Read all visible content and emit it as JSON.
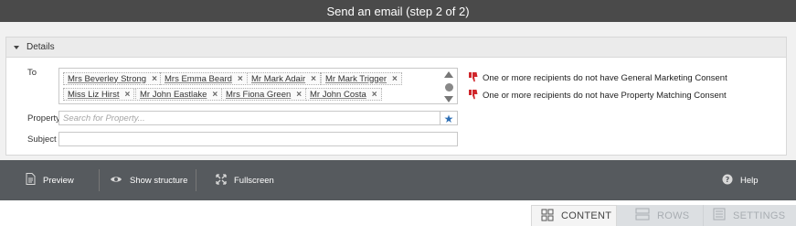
{
  "window": {
    "title": "Send an email (step 2 of 2)"
  },
  "details": {
    "header": "Details",
    "to_label": "To",
    "recipients": [
      "Mrs Beverley Strong",
      "Mrs Emma Beard",
      "Mr Mark Adair",
      "Mr Mark Trigger",
      "Miss Liz Hirst",
      "Mr John Eastlake",
      "Mrs Fiona Green",
      "Mr John Costa"
    ],
    "remove_glyph": "×",
    "property_label": "Property",
    "property_placeholder": "Search for Property...",
    "subject_label": "Subject",
    "subject_value": "",
    "warnings": [
      "One or more recipients do not have General Marketing Consent",
      "One or more recipients do not have Property Matching Consent"
    ]
  },
  "toolbar": {
    "preview": "Preview",
    "show_structure": "Show structure",
    "fullscreen": "Fullscreen",
    "help": "Help"
  },
  "tabs": [
    {
      "label": "CONTENT",
      "icon": "grid-icon",
      "active": true
    },
    {
      "label": "ROWS",
      "icon": "rows-icon",
      "active": false
    },
    {
      "label": "SETTINGS",
      "icon": "settings-doc-icon",
      "active": false
    }
  ],
  "colors": {
    "titlebar": "#4a4a4a",
    "toolbar": "#565a5e",
    "warning": "#d0262b",
    "star": "#2e6fb5",
    "inactive_tab": "#dcdfe2"
  }
}
